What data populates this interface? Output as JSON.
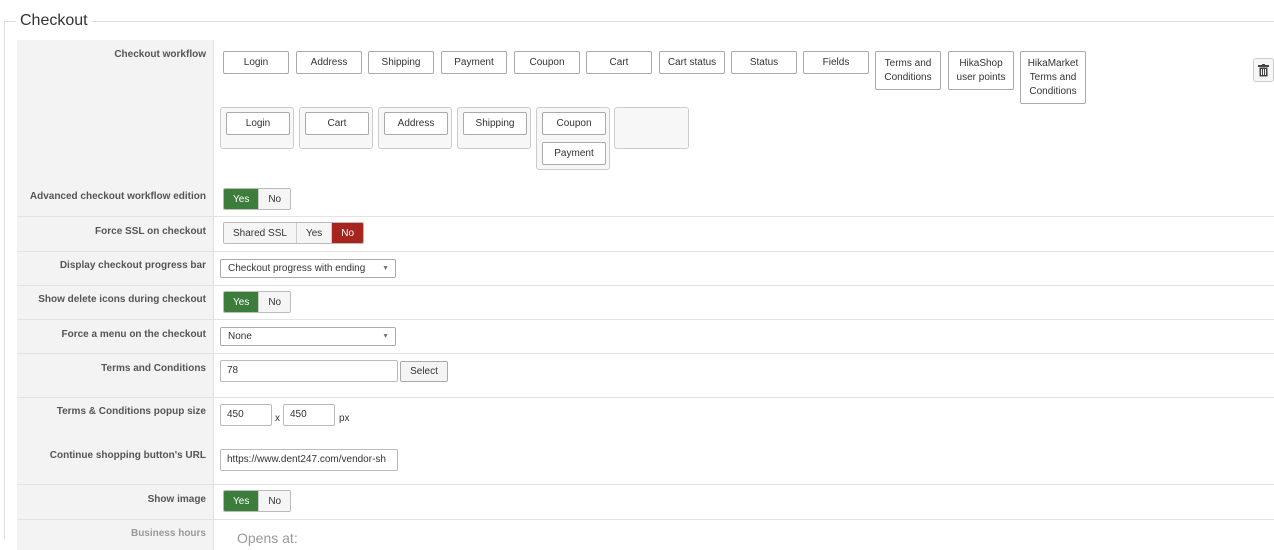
{
  "legend": "Checkout",
  "workflow": {
    "label": "Checkout workflow",
    "available": [
      "Login",
      "Address",
      "Shipping",
      "Payment",
      "Coupon",
      "Cart",
      "Cart status",
      "Status",
      "Fields",
      "Terms and Conditions",
      "HikaShop user points",
      "HikaMarket Terms and Conditions"
    ],
    "steps": [
      [
        "Login"
      ],
      [
        "Cart"
      ],
      [
        "Address"
      ],
      [
        "Shipping"
      ],
      [
        "Coupon",
        "Payment"
      ],
      []
    ]
  },
  "advanced": {
    "label": "Advanced checkout workflow edition",
    "options": [
      "Yes",
      "No"
    ],
    "selected": "Yes"
  },
  "force_ssl": {
    "label": "Force SSL on checkout",
    "options": [
      "Shared SSL",
      "Yes",
      "No"
    ],
    "selected": "No"
  },
  "progress_bar": {
    "label": "Display checkout progress bar",
    "value": "Checkout progress with ending"
  },
  "delete_icons": {
    "label": "Show delete icons during checkout",
    "options": [
      "Yes",
      "No"
    ],
    "selected": "Yes"
  },
  "force_menu": {
    "label": "Force a menu on the checkout",
    "value": "None"
  },
  "terms": {
    "label": "Terms and Conditions",
    "value": "78",
    "button": "Select"
  },
  "popup_size": {
    "label": "Terms & Conditions popup size",
    "width": "450",
    "height": "450",
    "sep": "x",
    "unit": "px"
  },
  "continue_url": {
    "label": "Continue shopping button's URL",
    "value": "https://www.dent247.com/vendor-sh"
  },
  "show_image": {
    "label": "Show image",
    "options": [
      "Yes",
      "No"
    ],
    "selected": "Yes"
  },
  "business_hours": {
    "label": "Business hours",
    "value": "Opens at:"
  },
  "icons": {
    "trash": "trash-icon",
    "arrow": "chevron-down-icon"
  },
  "colors": {
    "yes": "#3c7d3c",
    "no": "#a6261f"
  }
}
